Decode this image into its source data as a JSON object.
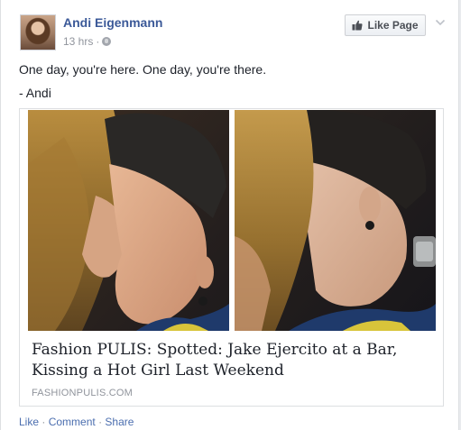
{
  "post": {
    "author": "Andi Eigenmann",
    "time": "13 hrs",
    "meta_separator": "·",
    "like_page_label": "Like Page",
    "text_line1": "One day, you're here. One day, you're there.",
    "text_line2": "- Andi"
  },
  "link": {
    "title": "Fashion PULIS: Spotted: Jake Ejercito at a Bar, Kissing a Hot Girl Last Weekend",
    "domain": "FASHIONPULIS.COM"
  },
  "actions": {
    "like": "Like",
    "comment": "Comment",
    "share": "Share",
    "separator": "·"
  },
  "icons": {
    "avatar": "profile-photo",
    "audience": "globe-icon",
    "like_button": "thumbs-up-icon",
    "options": "chevron-down-icon"
  },
  "colors": {
    "link_blue": "#3b5998",
    "action_blue": "#4b6eaf",
    "meta_gray": "#90949c",
    "text": "#1d2129"
  }
}
